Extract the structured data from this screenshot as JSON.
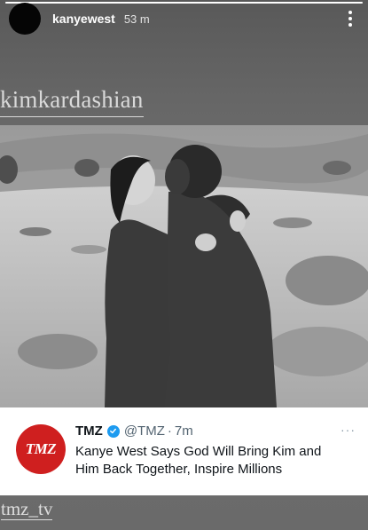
{
  "story": {
    "username": "kanyewest",
    "timestamp": "53 m",
    "progress": 1.0,
    "more_icon": "more-vertical-icon"
  },
  "mentions": {
    "top": "kimkardashian",
    "bottom": "tmz_tv"
  },
  "tweet": {
    "logo_text": "TMZ",
    "name": "TMZ",
    "handle": "@TMZ",
    "separator": "·",
    "time": "7m",
    "text": "Kanye West Says God Will Bring Kim and Him Back Together, Inspire Millions",
    "verified": true,
    "brand_color": "#cf1f1f",
    "verified_color": "#1d9bf0"
  }
}
